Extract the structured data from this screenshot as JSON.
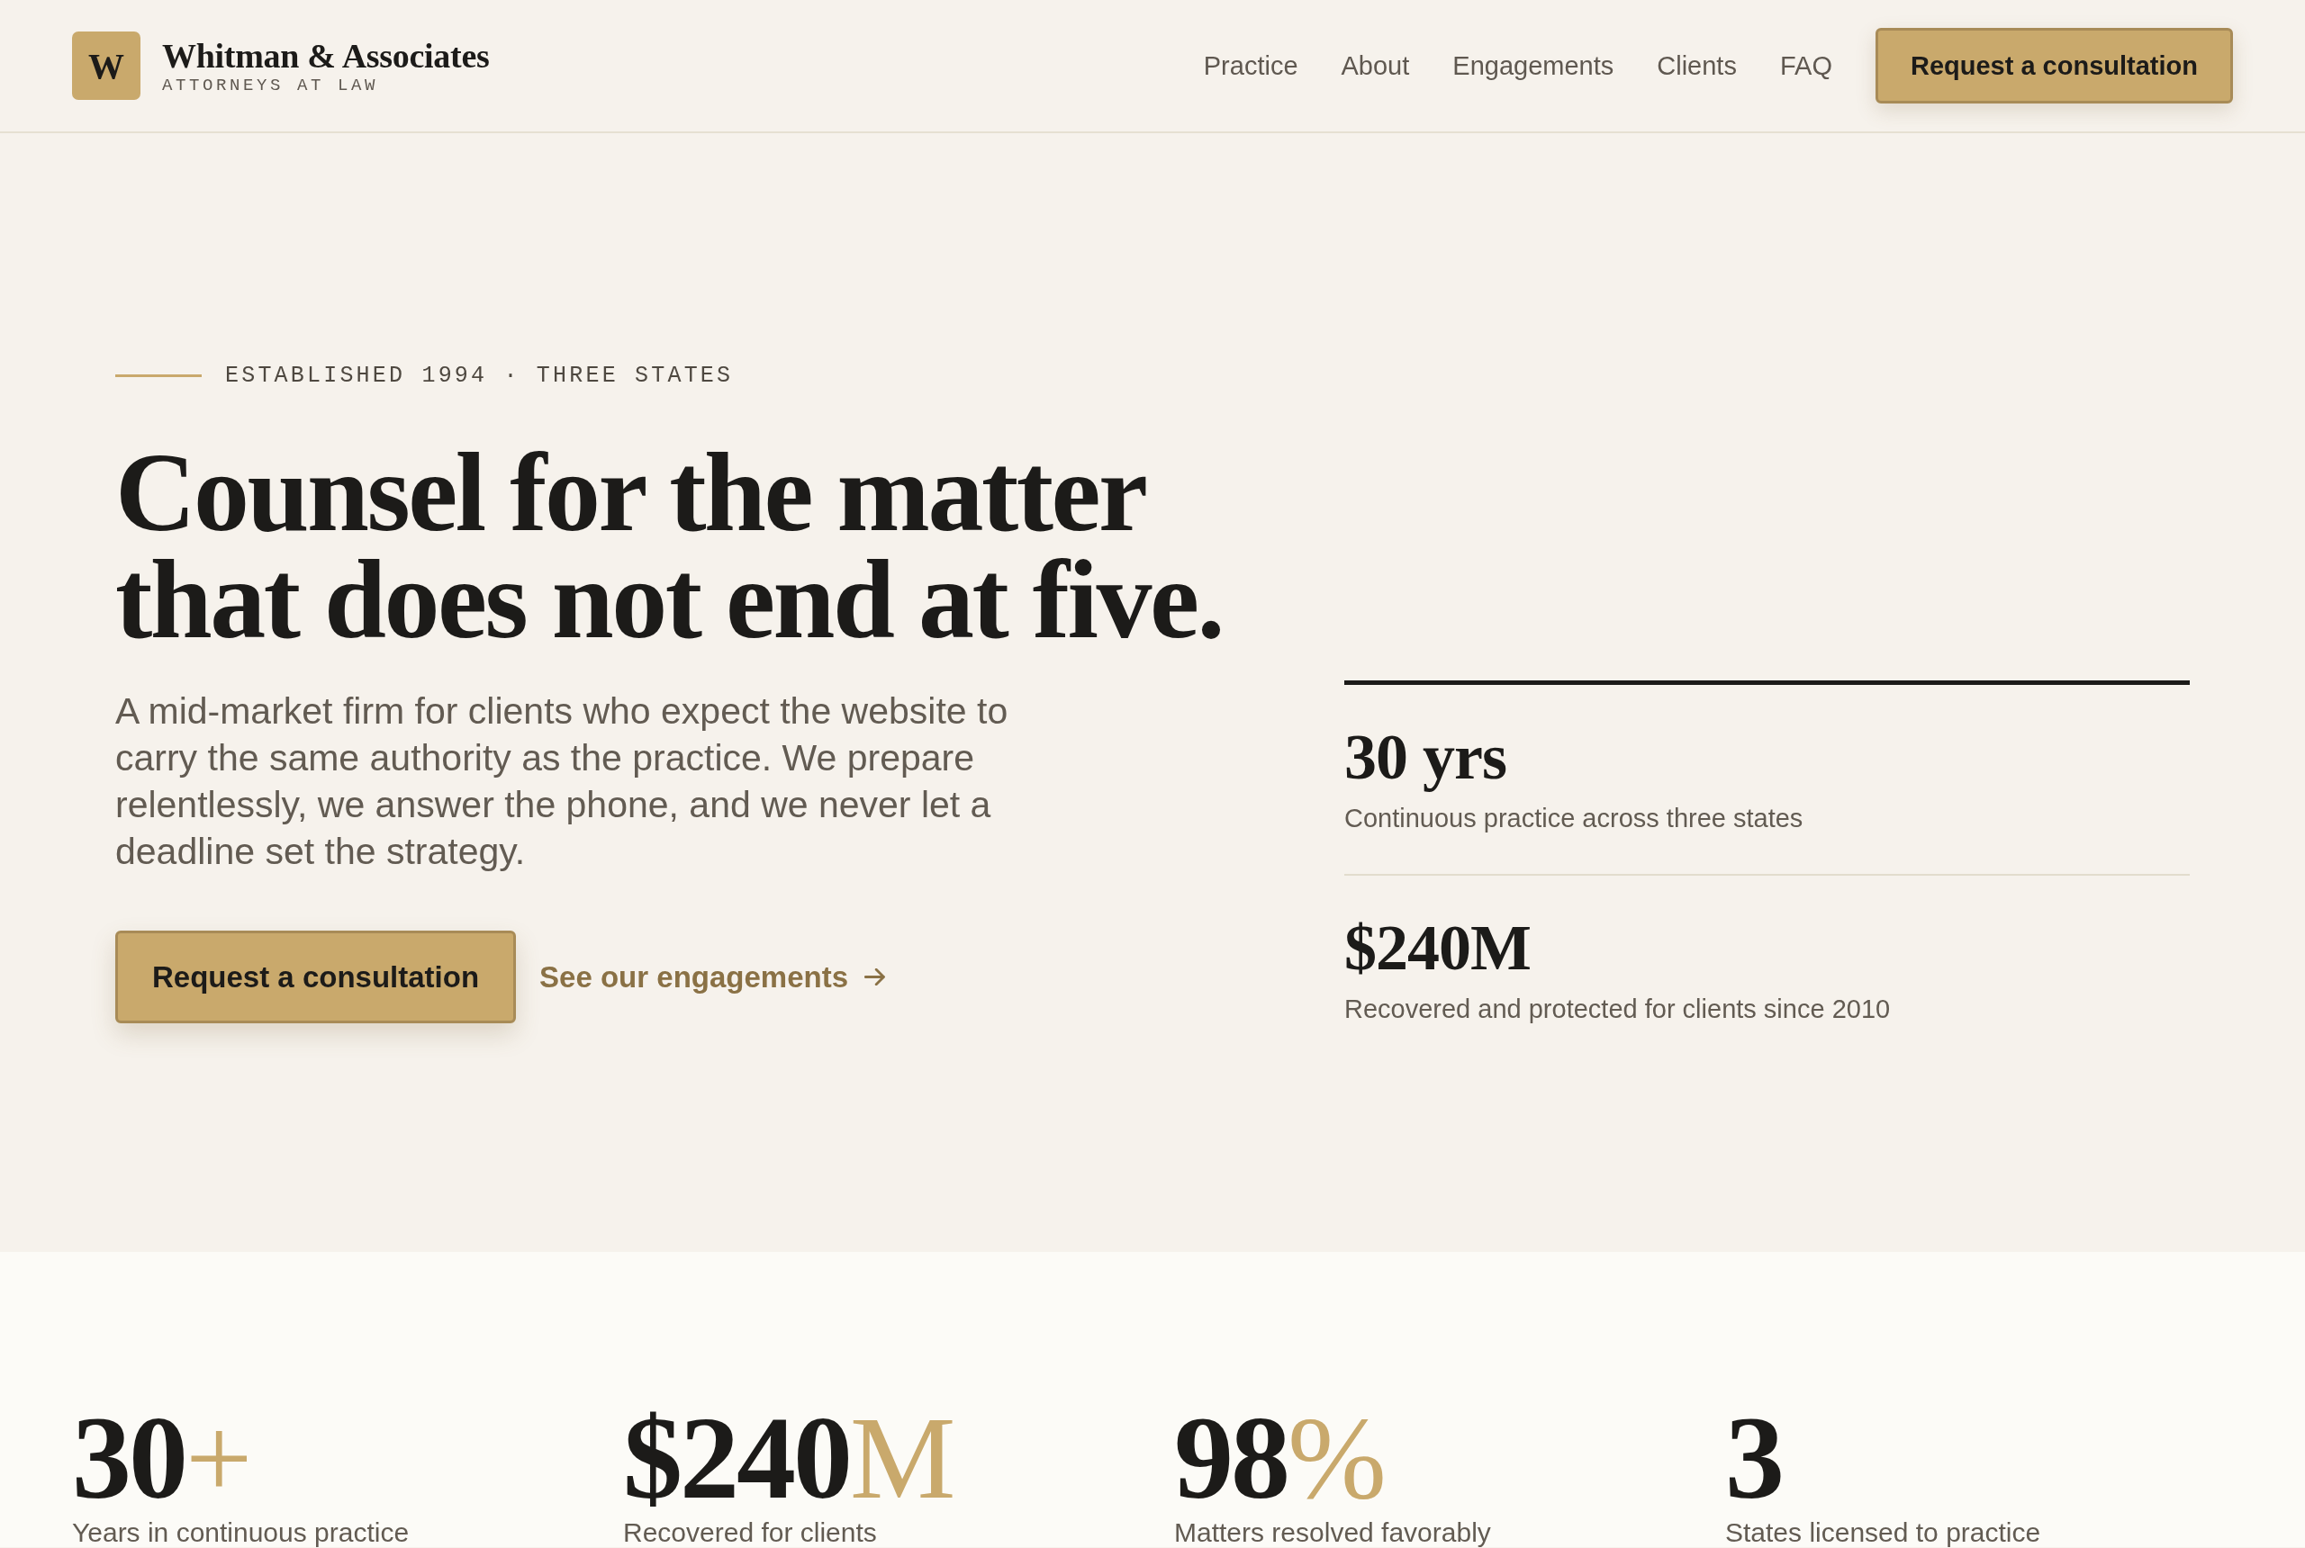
{
  "header": {
    "logo_letter": "W",
    "brand_name": "Whitman & Associates",
    "brand_tagline": "ATTORNEYS AT LAW",
    "nav": [
      "Practice",
      "About",
      "Engagements",
      "Clients",
      "FAQ"
    ],
    "cta": "Request a consultation"
  },
  "hero": {
    "eyebrow": "ESTABLISHED 1994 · THREE STATES",
    "headline": "Counsel for the matter that does not end at five.",
    "intro": "A mid-market firm for clients who expect the website to carry the same authority as the practice. We prepare relentlessly, we answer the phone, and we never let a deadline set the strategy.",
    "primary_button": "Request a consultation",
    "secondary_link": "See our engagements"
  },
  "hero_stats": [
    {
      "value": "30 yrs",
      "label": "Continuous practice across three states"
    },
    {
      "value": "$240M",
      "label": "Recovered and protected for clients since 2010"
    }
  ],
  "stats": [
    {
      "value": "30",
      "suffix": "+",
      "label": "Years in continuous practice"
    },
    {
      "value": "$240",
      "suffix": "M",
      "label": "Recovered for clients"
    },
    {
      "value": "98",
      "suffix": "%",
      "label": "Matters resolved favorably"
    },
    {
      "value": "3",
      "label": "States licensed to practice"
    }
  ]
}
